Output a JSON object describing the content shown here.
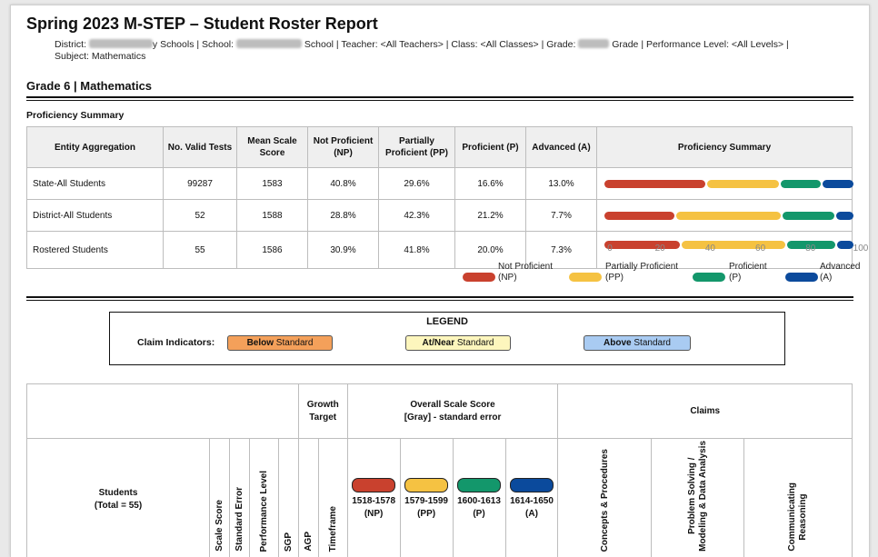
{
  "report": {
    "title": "Spring 2023 M-STEP – Student Roster Report",
    "filters": {
      "district_label": "District:",
      "district_suffix": "y Schools |",
      "school_label": "School:",
      "school_suffix": "School |",
      "teacher": "Teacher: <All Teachers> |",
      "class": "Class: <All Classes> |",
      "grade_label": "Grade:",
      "grade_suffix": "Grade |",
      "level": "Performance Level: <All Levels> |",
      "subject": "Subject: Mathematics"
    },
    "section_title": "Grade 6 | Mathematics"
  },
  "proficiency": {
    "label": "Proficiency Summary",
    "headers": [
      "Entity Aggregation",
      "No. Valid Tests",
      "Mean Scale Score",
      "Not Proficient (NP)",
      "Partially Proficient (PP)",
      "Proficient (P)",
      "Advanced (A)",
      "Proficiency Summary"
    ],
    "rows": [
      {
        "entity": "State-All Students",
        "tests": "99287",
        "mean": "1583",
        "np": "40.8%",
        "pp": "29.6%",
        "p": "16.6%",
        "a": "13.0%"
      },
      {
        "entity": "District-All Students",
        "tests": "52",
        "mean": "1588",
        "np": "28.8%",
        "pp": "42.3%",
        "p": "21.2%",
        "a": "7.7%"
      },
      {
        "entity": "Rostered Students",
        "tests": "55",
        "mean": "1586",
        "np": "30.9%",
        "pp": "41.8%",
        "p": "20.0%",
        "a": "7.3%"
      }
    ],
    "axis_ticks": [
      "0",
      "20",
      "40",
      "60",
      "80",
      "100"
    ],
    "legend": [
      {
        "label": "Not Proficient",
        "abbr": "(NP)",
        "color": "#c9412e"
      },
      {
        "label": "Partially Proficient",
        "abbr": "(PP)",
        "color": "#f5c242"
      },
      {
        "label": "Proficient",
        "abbr": "(P)",
        "color": "#13976b"
      },
      {
        "label": "Advanced",
        "abbr": "(A)",
        "color": "#0b4a9c"
      }
    ]
  },
  "chart_data": {
    "type": "bar",
    "categories": [
      "State-All Students",
      "District-All Students",
      "Rostered Students"
    ],
    "series": [
      {
        "name": "Not Proficient (NP)",
        "values": [
          40.8,
          28.8,
          30.9
        ]
      },
      {
        "name": "Partially Proficient (PP)",
        "values": [
          29.6,
          42.3,
          41.8
        ]
      },
      {
        "name": "Proficient (P)",
        "values": [
          16.6,
          21.2,
          20.0
        ]
      },
      {
        "name": "Advanced (A)",
        "values": [
          13.0,
          7.7,
          7.3
        ]
      }
    ],
    "stacked": true,
    "orientation": "horizontal",
    "xlim": [
      0,
      100
    ]
  },
  "legend_box": {
    "title": "LEGEND",
    "claim_label": "Claim Indicators:",
    "below": {
      "bold": "Below",
      "rest": " Standard",
      "color": "#f4a05a"
    },
    "near": {
      "bold": "At/Near",
      "rest": " Standard",
      "color": "#fdf6bd"
    },
    "above": {
      "bold": "Above",
      "rest": " Standard",
      "color": "#a9cbf2"
    }
  },
  "roster": {
    "growth_target": "Growth Target",
    "overall_title": "Overall Scale Score",
    "overall_sub": "[Gray] - standard error",
    "claims": "Claims",
    "students": "Students",
    "total": "(Total = 55)",
    "cols": {
      "scale_score": "Scale Score",
      "standard_error": "Standard Error",
      "performance_level": "Performance Level",
      "sgp": "SGP",
      "agp": "AGP",
      "timeframe": "Timeframe"
    },
    "ranges": [
      {
        "range": "1518-1578",
        "abbr": "(NP)",
        "color": "#c9412e"
      },
      {
        "range": "1579-1599",
        "abbr": "(PP)",
        "color": "#f5c242"
      },
      {
        "range": "1600-1613",
        "abbr": "(P)",
        "color": "#13976b"
      },
      {
        "range": "1614-1650",
        "abbr": "(A)",
        "color": "#0b4a9c"
      }
    ],
    "claim_cols": {
      "c1": "Concepts & Procedures",
      "c2a": "Problem Solving /",
      "c2b": "Modeling & Data Analysis",
      "c3a": "Communicating",
      "c3b": "Reasoning"
    }
  }
}
